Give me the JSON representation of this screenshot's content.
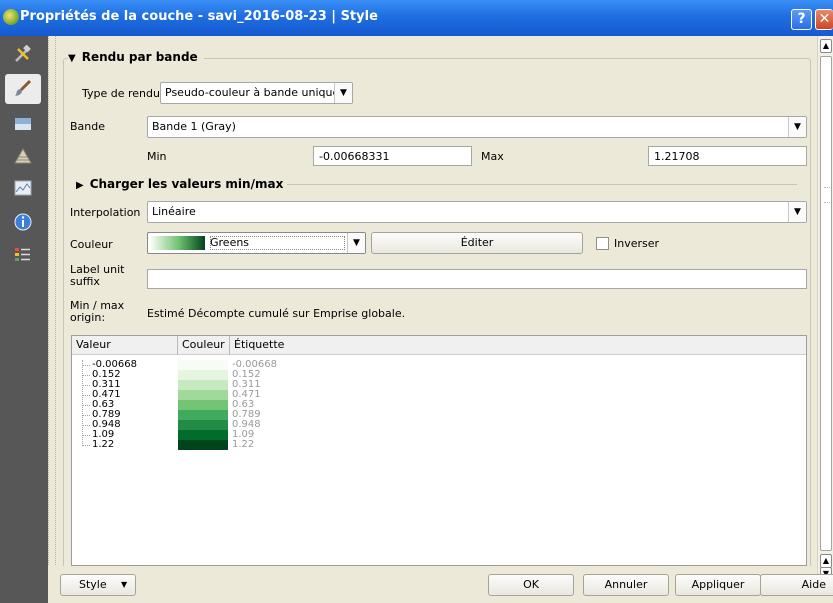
{
  "window": {
    "title": "Propriétés de la couche - savi_2016-08-23 | Style",
    "help_glyph": "?",
    "close_glyph": "✕"
  },
  "sidebar": {
    "items": [
      {
        "icon": "tools-icon"
      },
      {
        "icon": "paintbrush-icon",
        "active": true
      },
      {
        "icon": "transparency-icon"
      },
      {
        "icon": "pyramids-icon"
      },
      {
        "icon": "histogram-icon"
      },
      {
        "icon": "info-icon"
      },
      {
        "icon": "legend-icon"
      }
    ]
  },
  "render": {
    "header": "Rendu par bande",
    "type_label": "Type de rendu",
    "type_value": "Pseudo-couleur à bande unique",
    "band_label": "Bande",
    "band_value": "Bande 1 (Gray)",
    "min_label": "Min",
    "min_value": "-0.00668331",
    "max_label": "Max",
    "max_value": "1.21708",
    "load_minmax_label": "Charger les valeurs min/max",
    "interpolation_label": "Interpolation",
    "interpolation_value": "Linéaire",
    "color_label": "Couleur",
    "color_ramp": "Greens",
    "edit_button": "Éditer",
    "invert_label": "Inverser",
    "invert_checked": false,
    "label_unit_label": "Label unit suffix",
    "label_unit_value": "",
    "minmax_origin_label": "Min / max origin:",
    "minmax_origin_value": "Estimé Décompte cumulé sur Emprise globale."
  },
  "table": {
    "columns": [
      "Valeur",
      "Couleur",
      "Étiquette"
    ],
    "rows": [
      {
        "value": "-0.00668",
        "color": "#f7fcf5",
        "label": "-0.00668"
      },
      {
        "value": "0.152",
        "color": "#e5f5e0",
        "label": "0.152"
      },
      {
        "value": "0.311",
        "color": "#c7e9c0",
        "label": "0.311"
      },
      {
        "value": "0.471",
        "color": "#a1d99b",
        "label": "0.471"
      },
      {
        "value": "0.63",
        "color": "#74c476",
        "label": "0.63"
      },
      {
        "value": "0.789",
        "color": "#41ab5d",
        "label": "0.789"
      },
      {
        "value": "0.948",
        "color": "#238b45",
        "label": "0.948"
      },
      {
        "value": "1.09",
        "color": "#006d2c",
        "label": "1.09"
      },
      {
        "value": "1.22",
        "color": "#00441b",
        "label": "1.22"
      }
    ]
  },
  "footer": {
    "style_button": "Style",
    "ok_button": "OK",
    "cancel_button": "Annuler",
    "apply_button": "Appliquer",
    "help_button": "Aide"
  }
}
